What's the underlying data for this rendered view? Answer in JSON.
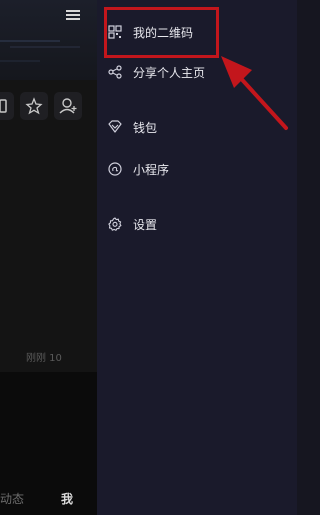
{
  "underlying": {
    "time_text": "刚刚 10",
    "bottom_left": "动态",
    "bottom_right": "我"
  },
  "drawer": {
    "items": [
      {
        "icon": "qr-code-icon",
        "label": "我的二维码"
      },
      {
        "icon": "share-icon",
        "label": "分享个人主页"
      },
      {
        "icon": "wallet-icon",
        "label": "钱包"
      },
      {
        "icon": "mini-program-icon",
        "label": "小程序"
      },
      {
        "icon": "settings-gear-icon",
        "label": "设置"
      }
    ]
  },
  "colors": {
    "drawer_bg": "#1a1a2b",
    "highlight": "#c3161c"
  }
}
